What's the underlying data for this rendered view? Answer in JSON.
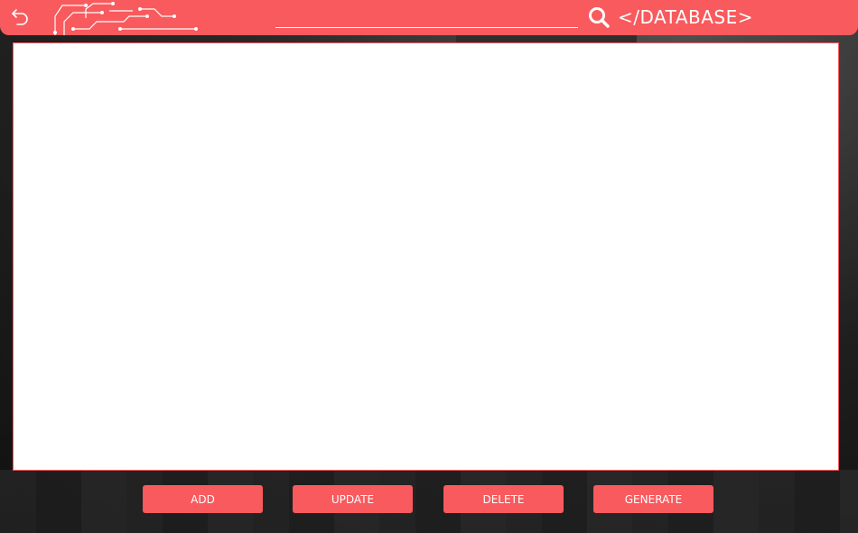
{
  "header": {
    "title": "</DATABASE>",
    "search": {
      "value": "",
      "placeholder": ""
    },
    "icons": {
      "back": "back-arrow-icon",
      "logo": "circuit-logo",
      "search": "search-icon"
    }
  },
  "actions": {
    "add_label": "ADD",
    "update_label": "UPDATE",
    "delete_label": "DELETE",
    "generate_label": "GENERATE"
  },
  "colors": {
    "accent": "#f85a5d",
    "panel": "#ffffff",
    "text_on_accent": "#ffffff"
  }
}
